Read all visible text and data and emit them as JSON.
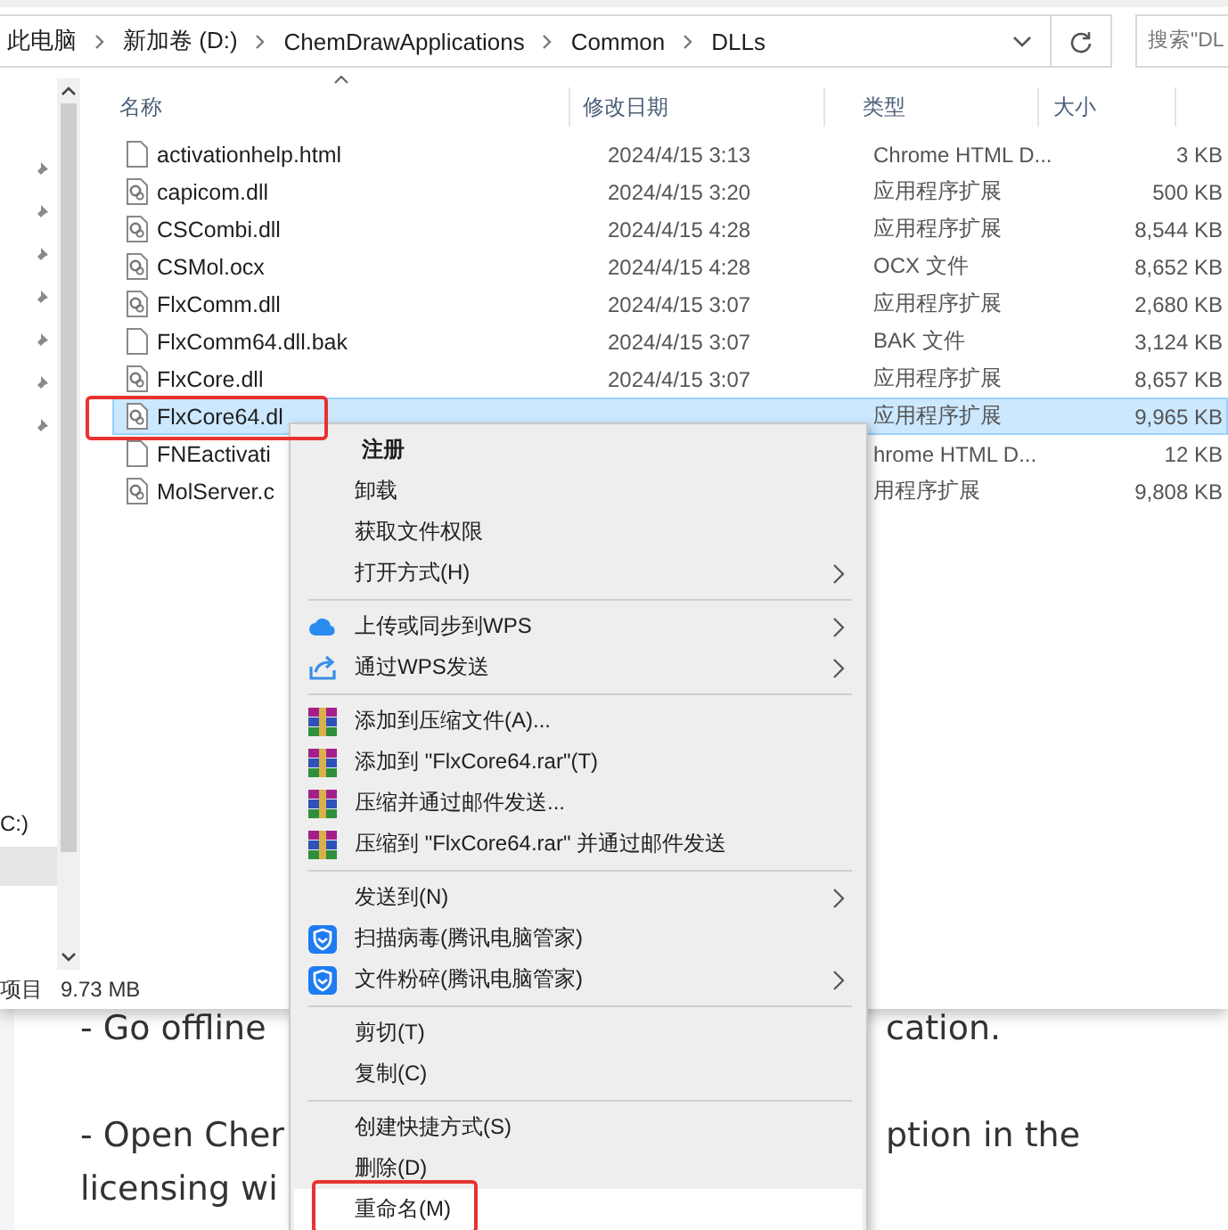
{
  "address_bar": {
    "crumbs": [
      "此电脑",
      "新加卷 (D:)",
      "ChemDrawApplications",
      "Common",
      "DLLs"
    ]
  },
  "search": {
    "placeholder": "搜索\"DL"
  },
  "columns": [
    "名称",
    "修改日期",
    "类型",
    "大小"
  ],
  "nav": {
    "drive": "C:)"
  },
  "files": [
    {
      "name": "activationhelp.html",
      "date": "2024/4/15 3:13",
      "type": "Chrome HTML D...",
      "size": "3 KB",
      "kind": "page",
      "selected": false
    },
    {
      "name": "capicom.dll",
      "date": "2024/4/15 3:20",
      "type": "应用程序扩展",
      "size": "500 KB",
      "kind": "gear",
      "selected": false
    },
    {
      "name": "CSCombi.dll",
      "date": "2024/4/15 4:28",
      "type": "应用程序扩展",
      "size": "8,544 KB",
      "kind": "gear",
      "selected": false
    },
    {
      "name": "CSMol.ocx",
      "date": "2024/4/15 4:28",
      "type": "OCX 文件",
      "size": "8,652 KB",
      "kind": "gear",
      "selected": false
    },
    {
      "name": "FlxComm.dll",
      "date": "2024/4/15 3:07",
      "type": "应用程序扩展",
      "size": "2,680 KB",
      "kind": "gear",
      "selected": false
    },
    {
      "name": "FlxComm64.dll.bak",
      "date": "2024/4/15 3:07",
      "type": "BAK 文件",
      "size": "3,124 KB",
      "kind": "page",
      "selected": false
    },
    {
      "name": "FlxCore.dll",
      "date": "2024/4/15 3:07",
      "type": "应用程序扩展",
      "size": "8,657 KB",
      "kind": "gear",
      "selected": false
    },
    {
      "name": "FlxCore64.dl",
      "type": "应用程序扩展",
      "size": "9,965 KB",
      "kind": "gear",
      "selected": true
    },
    {
      "name": "FNEactivati",
      "type": "hrome HTML D...",
      "size": "12 KB",
      "kind": "page",
      "selected": false
    },
    {
      "name": "MolServer.c",
      "type": "用程序扩展",
      "size": "9,808 KB",
      "kind": "gear",
      "selected": false
    }
  ],
  "status_bar": {
    "count": "项目",
    "size": "9.73 MB"
  },
  "context_menu": {
    "groups": [
      [
        {
          "label": "注册",
          "kind": "none",
          "default": true,
          "submenu": false,
          "selected": false
        },
        {
          "label": "卸载",
          "kind": "none",
          "default": false,
          "submenu": false,
          "selected": false
        },
        {
          "label": "获取文件权限",
          "kind": "none",
          "default": false,
          "submenu": false,
          "selected": false
        },
        {
          "label": "打开方式(H)",
          "kind": "none",
          "default": false,
          "submenu": true,
          "selected": false
        }
      ],
      [
        {
          "label": "上传或同步到WPS",
          "kind": "cloud",
          "default": false,
          "submenu": true,
          "selected": false
        },
        {
          "label": "通过WPS发送",
          "kind": "share",
          "default": false,
          "submenu": true,
          "selected": false
        }
      ],
      [
        {
          "label": "添加到压缩文件(A)...",
          "kind": "archive",
          "default": false,
          "submenu": false,
          "selected": false
        },
        {
          "label": "添加到 \"FlxCore64.rar\"(T)",
          "kind": "archive",
          "default": false,
          "submenu": false,
          "selected": false
        },
        {
          "label": "压缩并通过邮件发送...",
          "kind": "archive",
          "default": false,
          "submenu": false,
          "selected": false
        },
        {
          "label": "压缩到 \"FlxCore64.rar\" 并通过邮件发送",
          "kind": "archive",
          "default": false,
          "submenu": false,
          "selected": false
        }
      ],
      [
        {
          "label": "发送到(N)",
          "kind": "none",
          "default": false,
          "submenu": true,
          "selected": false
        },
        {
          "label": "扫描病毒(腾讯电脑管家)",
          "kind": "shield",
          "default": false,
          "submenu": false,
          "selected": false
        },
        {
          "label": "文件粉碎(腾讯电脑管家)",
          "kind": "shield",
          "default": false,
          "submenu": true,
          "selected": false
        }
      ],
      [
        {
          "label": "剪切(T)",
          "kind": "none",
          "default": false,
          "submenu": false,
          "selected": false
        },
        {
          "label": "复制(C)",
          "kind": "none",
          "default": false,
          "submenu": false,
          "selected": false
        }
      ],
      [
        {
          "label": "创建快捷方式(S)",
          "kind": "none",
          "default": false,
          "submenu": false,
          "selected": false
        },
        {
          "label": "删除(D)",
          "kind": "none",
          "default": false,
          "submenu": false,
          "selected": false
        },
        {
          "label": "重命名(M)",
          "kind": "none",
          "default": false,
          "submenu": false,
          "selected": true
        }
      ]
    ]
  },
  "background_page": {
    "lines": [
      {
        "left": "- Go offline",
        "right": "cation."
      },
      {
        "left": "- Open Cher",
        "right": "ption in the"
      },
      {
        "left": "licensing wi"
      }
    ]
  }
}
